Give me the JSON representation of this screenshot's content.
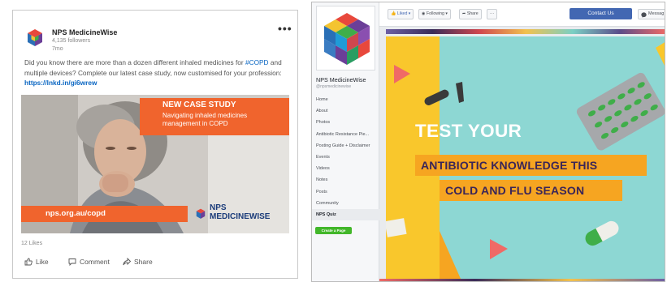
{
  "linkedin": {
    "org_name": "NPS MedicineWise",
    "followers": "4,135 followers",
    "time_ago": "7mo",
    "more_icon": "more-horizontal-icon",
    "text_before_tag": "Did you know there are more than a dozen different inhaled medicines for ",
    "hashtag": "#COPD",
    "text_after_tag": " and multiple devices? Complete our latest case study, now customised for your profession: ",
    "link": "https://lnkd.in/gi6wrew",
    "image": {
      "banner_title": "NEW CASE STUDY",
      "banner_subtitle": "Navigating inhaled medicines management in COPD",
      "url": "nps.org.au/copd",
      "brand_line1": "NPS",
      "brand_line2": "MEDICINEWISE"
    },
    "likes": "12 Likes",
    "actions": {
      "like": "Like",
      "comment": "Comment",
      "share": "Share"
    }
  },
  "facebook": {
    "page_name": "NPS MedicineWise",
    "handle": "@npsmedicinewise",
    "nav": [
      {
        "label": "Home"
      },
      {
        "label": "About"
      },
      {
        "label": "Photos"
      },
      {
        "label": "Antibiotic Resistance Pie..."
      },
      {
        "label": "Posting Guide + Disclaimer"
      },
      {
        "label": "Events"
      },
      {
        "label": "Videos"
      },
      {
        "label": "Notes"
      },
      {
        "label": "Posts"
      },
      {
        "label": "Community"
      },
      {
        "label": "NPS Quiz"
      }
    ],
    "create_page": "Create a Page",
    "toolbar": {
      "liked": "Liked",
      "following": "Following",
      "share": "Share",
      "more": "···",
      "contact": "Contact Us",
      "message": "Messag"
    },
    "graphic": {
      "headline": "TEST YOUR",
      "line1": "ANTIBIOTIC KNOWLEDGE THIS",
      "line2": "COLD AND FLU SEASON"
    }
  },
  "colors": {
    "linkedin_link": "#0a66c2",
    "nps_orange": "#f0642d",
    "nps_navy": "#1b3c7a",
    "fb_blue": "#4267b2",
    "fb_green": "#42b72a",
    "teal": "#8dd7d3",
    "yellow": "#f9c72c",
    "amber": "#f6a521",
    "purple": "#3a2558"
  }
}
